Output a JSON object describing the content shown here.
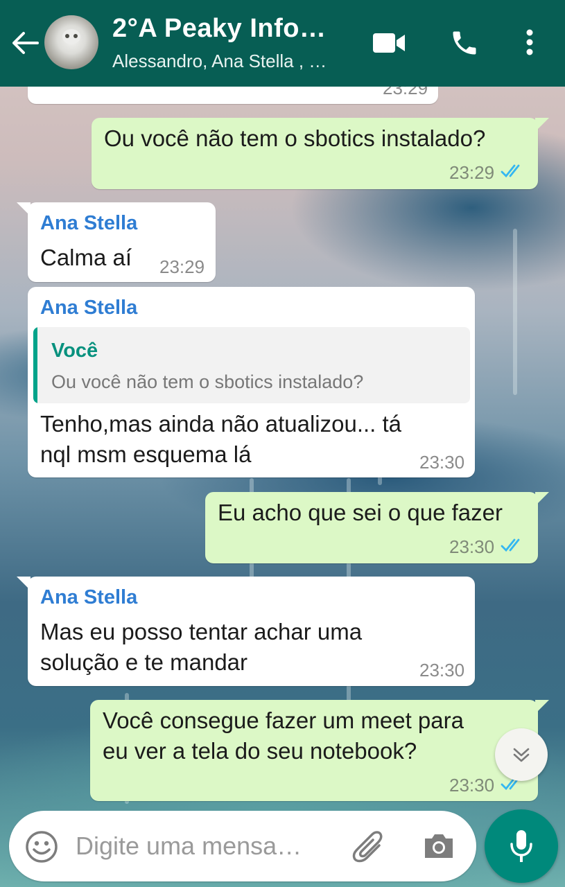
{
  "header": {
    "title": "2°A Peaky Info…",
    "subtitle": "Alessandro, Ana Stella , …"
  },
  "messages": [
    {
      "type": "outgoing",
      "text": "Ou você não tem o sbotics instalado?",
      "time": "23:29",
      "status": "read"
    },
    {
      "type": "incoming",
      "sender": "Ana Stella",
      "text": "Calma aí",
      "time": "23:29"
    },
    {
      "type": "incoming",
      "sender": "Ana Stella",
      "quote": {
        "sender": "Você",
        "text": "Ou você não tem o sbotics instalado?"
      },
      "line1": "Tenho,mas ainda não atualizou... tá",
      "line2": "nql msm esquema lá",
      "time": "23:30"
    },
    {
      "type": "outgoing",
      "text": "Eu acho que sei o que fazer",
      "time": "23:30",
      "status": "read"
    },
    {
      "type": "incoming",
      "sender": "Ana Stella",
      "line1": "Mas eu posso tentar achar uma",
      "line2": "solução e te mandar",
      "time": "23:30"
    },
    {
      "type": "outgoing",
      "line1": "Você consegue fazer um meet para",
      "line2": "eu ver a tela do seu notebook?",
      "time": "23:30",
      "status": "read"
    }
  ],
  "partial_top": {
    "time": "23:29"
  },
  "composer": {
    "placeholder": "Digite uma mensa…"
  },
  "colors": {
    "header": "#075e54",
    "outgoing_bubble": "#dcf8c6",
    "incoming_bubble": "#ffffff",
    "sender_name": "#2f7dd3",
    "quote_bar": "#00a38a",
    "read_ticks": "#34b7f1",
    "mic_button": "#00897b"
  },
  "icons": [
    "back-arrow-icon",
    "video-call-icon",
    "voice-call-icon",
    "more-options-icon",
    "chevron-double-down-icon",
    "emoji-icon",
    "attach-icon",
    "camera-icon",
    "mic-icon",
    "read-ticks-icon"
  ]
}
